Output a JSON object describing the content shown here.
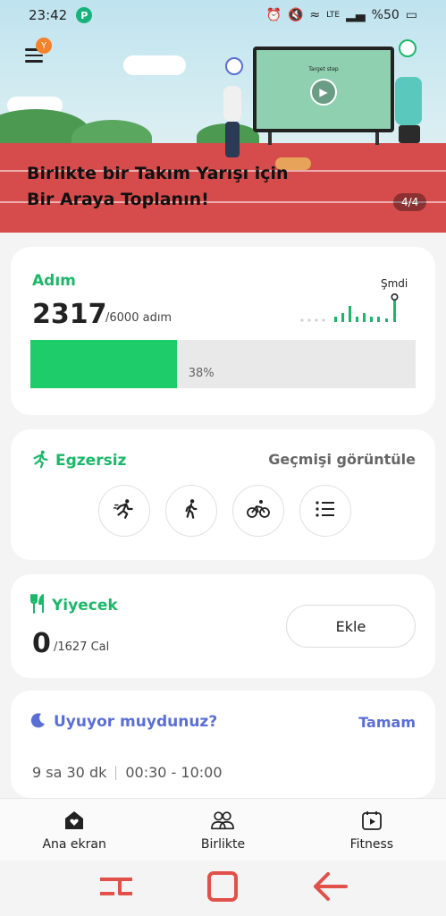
{
  "status_bar": {
    "time": "23:42",
    "app_badge": "P",
    "battery": "%50",
    "network": "LTE"
  },
  "hero": {
    "title": "Birlikte bir Takım Yarışı için Bir Araya Toplanın!",
    "page_indicator": "4/4",
    "screen_caption": "Target step",
    "menu_badge": "Y"
  },
  "steps": {
    "label": "Adım",
    "value": "2317",
    "goal": "/6000 adım",
    "now_label": "Şmdi",
    "progress_percent_text": "38%",
    "progress_fraction": 0.38
  },
  "exercise": {
    "title": "Egzersiz",
    "history_link": "Geçmişi görüntüle",
    "types": [
      {
        "icon": "running-icon"
      },
      {
        "icon": "walking-icon"
      },
      {
        "icon": "cycling-icon"
      },
      {
        "icon": "list-icon"
      }
    ]
  },
  "food": {
    "title": "Yiyecek",
    "value": "0",
    "goal": "/1627 Cal",
    "add_label": "Ekle"
  },
  "sleep": {
    "title": "Uyuyor muydunuz?",
    "confirm_label": "Tamam",
    "duration": "9 sa 30 dk",
    "range": "00:30 - 10:00"
  },
  "bottom_nav": {
    "items": [
      {
        "label": "Ana ekran",
        "icon": "home-heart-icon"
      },
      {
        "label": "Birlikte",
        "icon": "people-icon"
      },
      {
        "label": "Fitness",
        "icon": "fitness-play-icon"
      }
    ]
  },
  "colors": {
    "accent_green": "#1cb86a",
    "progress_green": "#1fcc6a",
    "sleep_blue": "#5a6fd6",
    "track_red": "#d64c4c",
    "nav_red": "#e2504a"
  }
}
